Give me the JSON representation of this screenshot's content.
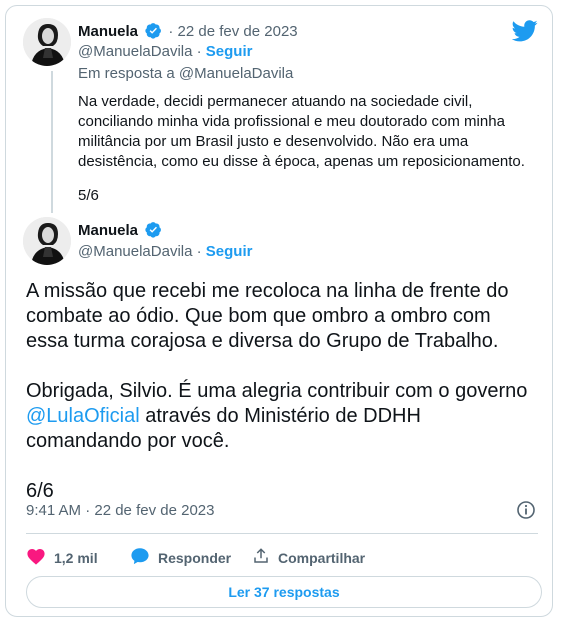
{
  "tweet1": {
    "name": "Manuela",
    "separator": "·",
    "date": "22 de fev de 2023",
    "handle": "@ManuelaDavila",
    "follow_separator": "·",
    "follow": "Seguir",
    "reply_to_prefix": "Em resposta a",
    "reply_to_handle": "@ManuelaDavila",
    "text": "Na verdade, decidi permanecer atuando na sociedade civil, conciliando minha vida profissional e meu doutorado com minha militância por um Brasil justo e desenvolvido. Não era uma desistência, como eu disse à época, apenas um reposicionamento.",
    "counter": "5/6"
  },
  "tweet2": {
    "name": "Manuela",
    "handle": "@ManuelaDavila",
    "follow_separator": "·",
    "follow": "Seguir",
    "para1": "A missão que recebi me recoloca na linha de frente do combate ao ódio. Que bom que ombro a ombro com essa turma corajosa e diversa do Grupo de Trabalho.",
    "para2_before": "Obrigada, Silvio. É uma alegria contribuir com o governo ",
    "para2_link": "@LulaOficial",
    "para2_after": " através do Ministério de DDHH comandando por você.",
    "counter": "6/6",
    "timestamp": "9:41 AM · 22 de fev de 2023"
  },
  "actions": {
    "likes": "1,2 mil",
    "reply": "Responder",
    "share": "Compartilhar"
  },
  "read_more": "Ler 37 respostas",
  "colors": {
    "brand_blue": "#1d9bf0",
    "like_pink": "#f91880",
    "text": "#0f1419",
    "muted": "#536471",
    "border": "#cfd9de"
  },
  "icons": [
    "twitter-bird-icon",
    "verified-badge-icon",
    "info-icon",
    "heart-icon",
    "reply-bubble-icon",
    "share-icon"
  ]
}
